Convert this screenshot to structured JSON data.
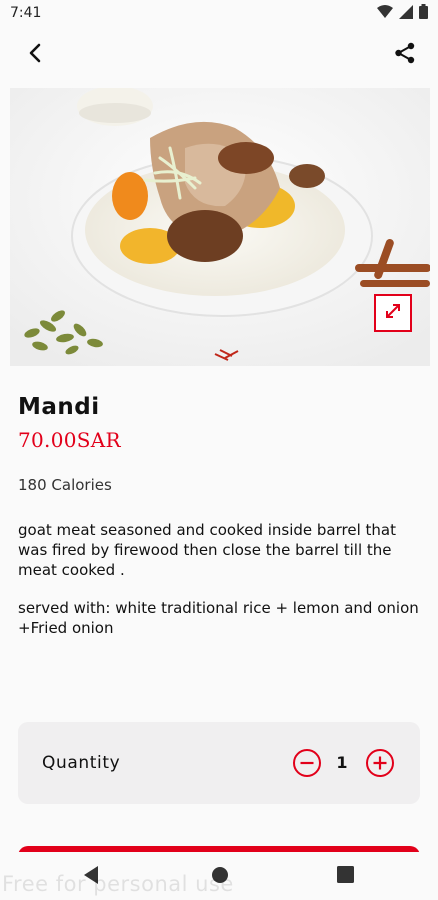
{
  "status": {
    "time": "7:41"
  },
  "product": {
    "name": "Mandi",
    "price": "70.00SAR",
    "calories": "180 Calories",
    "description": "goat meat seasoned and cooked inside barrel that was fired by firewood then close the barrel till the meat cooked .",
    "served_with": "served with: white traditional rice + lemon and onion +Fried onion"
  },
  "quantity": {
    "label": "Quantity",
    "value": "1"
  },
  "watermark": "Free for personal use",
  "colors": {
    "accent": "#e2001a",
    "card": "#f0eff0",
    "background": "#fafafa"
  },
  "icons": [
    "back-arrow-icon",
    "share-icon",
    "expand-icon",
    "minus-icon",
    "plus-icon",
    "wifi-icon",
    "signal-icon",
    "battery-icon",
    "nav-back-icon",
    "nav-home-icon",
    "nav-recent-icon"
  ]
}
